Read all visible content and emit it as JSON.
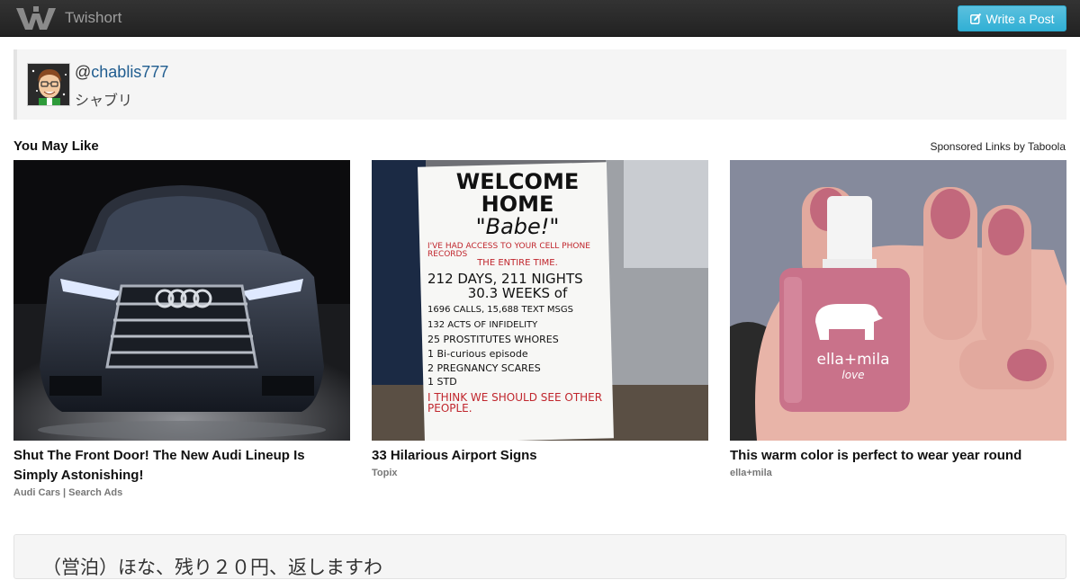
{
  "navbar": {
    "brand_name": "Twishort",
    "logo_icon": "twishort-logo-icon",
    "write_button_label": "Write a Post",
    "write_icon": "edit-icon"
  },
  "profile": {
    "handle_at": "@",
    "handle": "chablis777",
    "display_name": "シャブリ"
  },
  "recommendations": {
    "heading": "You May Like",
    "sponsored_label": "Sponsored Links by Taboola",
    "cards": [
      {
        "title": "Shut The Front Door! The New Audi Lineup Is Simply Astonishing!",
        "source": "Audi Cars | Search Ads"
      },
      {
        "title": "33 Hilarious Airport Signs",
        "source": "Topix"
      },
      {
        "title": "This warm color is perfect to wear year round",
        "source": "ella+mila"
      }
    ],
    "sign_lines": [
      "WELCOME HOME",
      "\"Babe!\"",
      "I'VE HAD ACCESS TO YOUR CELL PHONE RECORDS",
      "THE ENTIRE TIME.",
      "212 DAYS, 211 NIGHTS",
      "30.3 WEEKS of",
      "1696 CALLS, 15,688 TEXT MSGS",
      "132 ACTS OF INFIDELITY",
      "25 PROSTITUTES WHORES",
      "1 Bi-curious episode",
      "2 PREGNANCY SCARES",
      "1 STD",
      "I THINK WE SHOULD SEE OTHER PEOPLE."
    ],
    "bottle_label": "ella+mila",
    "bottle_sub": "love"
  },
  "post": {
    "text": "（営泊）ほな、残り２０円、返しますわ"
  }
}
